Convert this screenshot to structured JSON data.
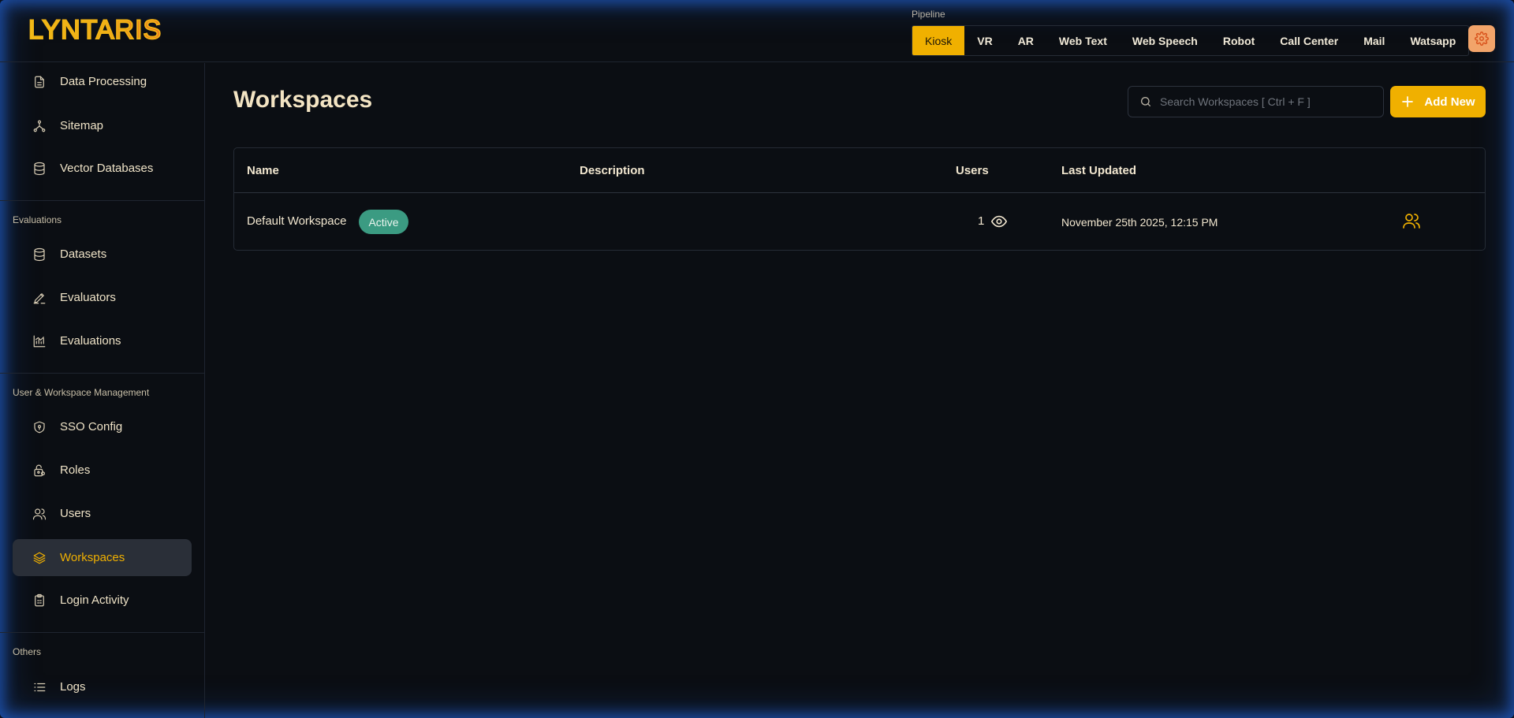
{
  "header": {
    "logo_text": "LYNTARIS",
    "pipeline_label": "Pipeline",
    "pipeline_tabs": [
      "Kiosk",
      "VR",
      "AR",
      "Web Text",
      "Web Speech",
      "Robot",
      "Call Center",
      "Mail",
      "Watsapp"
    ],
    "active_tab": "Kiosk",
    "settings_icon": "gear-icon"
  },
  "sidebar": {
    "items_top": [
      {
        "label": "Data Processing",
        "icon": "file-icon"
      },
      {
        "label": "Sitemap",
        "icon": "sitemap-icon"
      },
      {
        "label": "Vector Databases",
        "icon": "database-icon"
      }
    ],
    "sections": [
      {
        "title": "Evaluations",
        "items": [
          {
            "label": "Datasets",
            "icon": "database-icon"
          },
          {
            "label": "Evaluators",
            "icon": "pen-ruler-icon"
          },
          {
            "label": "Evaluations",
            "icon": "chart-icon"
          }
        ]
      },
      {
        "title": "User & Workspace Management",
        "items": [
          {
            "label": "SSO Config",
            "icon": "shield-icon"
          },
          {
            "label": "Roles",
            "icon": "lock-user-icon"
          },
          {
            "label": "Users",
            "icon": "users-icon"
          },
          {
            "label": "Workspaces",
            "icon": "layers-icon"
          },
          {
            "label": "Login Activity",
            "icon": "clipboard-icon"
          }
        ]
      },
      {
        "title": "Others",
        "items": [
          {
            "label": "Logs",
            "icon": "list-icon"
          }
        ]
      }
    ],
    "active_item": "Workspaces"
  },
  "main": {
    "title": "Workspaces",
    "search_placeholder": "Search Workspaces [ Ctrl + F ]",
    "add_label": "Add New",
    "table": {
      "columns": [
        "Name",
        "Description",
        "Users",
        "Last Updated"
      ],
      "rows": [
        {
          "name": "Default Workspace",
          "status": "Active",
          "description": "",
          "users": "1",
          "last_updated": "November 25th 2025, 12:15 PM"
        }
      ]
    }
  },
  "colors": {
    "accent": "#f0b000",
    "badge": "#3b9b82",
    "settings": "#f2a46a"
  }
}
